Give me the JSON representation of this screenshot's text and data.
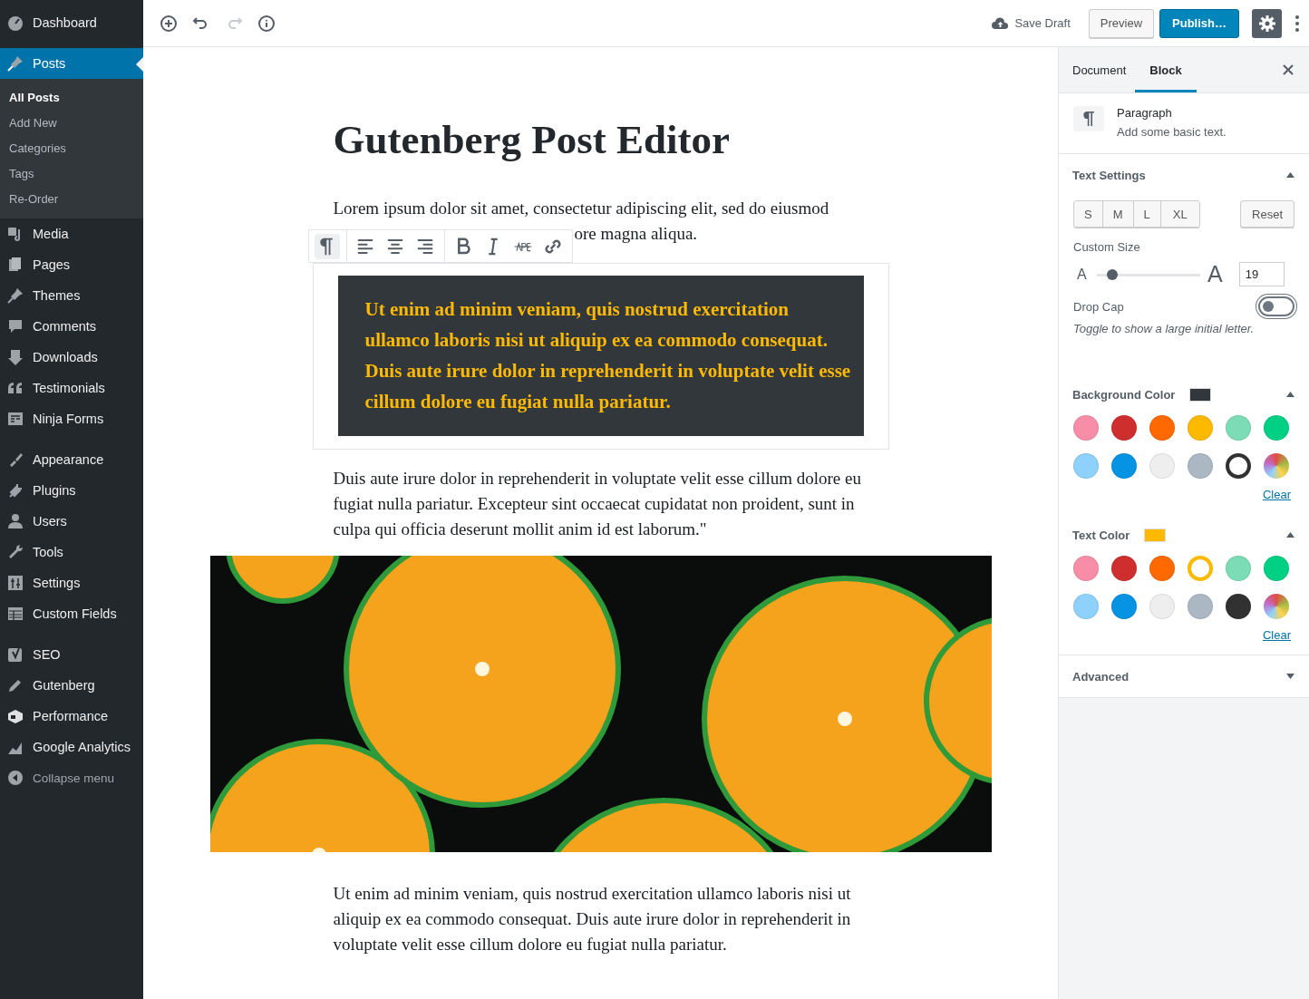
{
  "sidebar": {
    "groups": [
      {
        "items": [
          {
            "label": "Dashboard",
            "selected": false
          }
        ]
      },
      {
        "items": [
          {
            "label": "Posts",
            "selected": true,
            "children": [
              {
                "label": "All Posts",
                "selected": true
              },
              {
                "label": "Add New",
                "selected": false
              },
              {
                "label": "Categories",
                "selected": false
              },
              {
                "label": "Tags",
                "selected": false
              },
              {
                "label": "Re-Order",
                "selected": false
              }
            ]
          },
          {
            "label": "Media",
            "selected": false
          },
          {
            "label": "Pages",
            "selected": false
          },
          {
            "label": "Themes",
            "selected": false
          },
          {
            "label": "Comments",
            "selected": false
          },
          {
            "label": "Downloads",
            "selected": false
          },
          {
            "label": "Testimonials",
            "selected": false
          },
          {
            "label": "Ninja Forms",
            "selected": false
          }
        ]
      },
      {
        "items": [
          {
            "label": "Appearance",
            "selected": false
          },
          {
            "label": "Plugins",
            "selected": false
          },
          {
            "label": "Users",
            "selected": false
          },
          {
            "label": "Tools",
            "selected": false
          },
          {
            "label": "Settings",
            "selected": false
          },
          {
            "label": "Custom Fields",
            "selected": false
          }
        ]
      },
      {
        "items": [
          {
            "label": "SEO",
            "selected": false
          },
          {
            "label": "Gutenberg",
            "selected": false
          },
          {
            "label": "Performance",
            "selected": false
          },
          {
            "label": "Google Analytics",
            "selected": false
          }
        ]
      }
    ],
    "collapse_label": "Collapse menu"
  },
  "topbar": {
    "tools": [
      {
        "disabled": false
      },
      {
        "disabled": false
      },
      {
        "disabled": true
      },
      {
        "disabled": false
      }
    ],
    "save_draft": "Save Draft",
    "preview": "Preview",
    "publish": "Publish…",
    "settings_open": true
  },
  "editor": {
    "title": "Gutenberg Post Editor",
    "block_toolbar": [
      {
        "selected": true
      },
      {
        "selected": false
      },
      {
        "selected": false
      },
      {
        "selected": false
      },
      {
        "selected": false
      },
      {
        "selected": false
      },
      {
        "selected": false
      },
      {
        "selected": false
      }
    ],
    "blocks": [
      {
        "kind": "covered",
        "text": "Lorem ipsum dolor sit amet, consectetur adipiscing elit, sed do eiusmod",
        "tail": "ore magna aliqua."
      },
      {
        "kind": "highlight",
        "selected": true,
        "text": "Ut enim ad minim veniam, quis nostrud exercitation ullamco laboris nisi ut aliquip ex ea commodo consequat. Duis aute irure dolor in reprehenderit in voluptate velit esse cillum dolore eu fugiat nulla pariatur."
      },
      {
        "kind": "paragraph",
        "text": "Duis aute irure dolor in reprehenderit in voluptate velit esse cillum dolore eu fugiat nulla pariatur. Excepteur sint occaecat cupidatat non proident, sunt in culpa qui officia deserunt mollit anim id est laborum.\""
      },
      {
        "kind": "image"
      },
      {
        "kind": "paragraph",
        "text": "Ut enim ad minim veniam, quis nostrud exercitation ullamco laboris nisi ut aliquip ex ea commodo consequat. Duis aute irure dolor in reprehenderit in voluptate velit esse cillum dolore eu fugiat nulla pariatur."
      }
    ]
  },
  "settings": {
    "tabs": [
      {
        "label": "Document",
        "selected": false
      },
      {
        "label": "Block",
        "selected": true
      }
    ],
    "block": {
      "name": "Paragraph",
      "description": "Add some basic text."
    },
    "panels": [
      {
        "kind": "text",
        "title": "Text Settings",
        "expanded": true,
        "sizes": [
          {
            "label": "S",
            "selected": false
          },
          {
            "label": "M",
            "selected": false
          },
          {
            "label": "L",
            "selected": false
          },
          {
            "label": "XL",
            "selected": false
          }
        ],
        "reset": "Reset",
        "custom_size_label": "Custom Size",
        "small_a": "A",
        "large_a": "A",
        "slider": {
          "level": 0.15
        },
        "value": "19",
        "drop_cap": {
          "label": "Drop Cap",
          "on": false,
          "help": "Toggle to show a large initial letter."
        }
      },
      {
        "kind": "color",
        "title": "Background Color",
        "expanded": true,
        "color": "#32373c",
        "clear": "Clear",
        "swatches": [
          {
            "kind": "color",
            "color": "#f78da7",
            "selected": false
          },
          {
            "kind": "color",
            "color": "#cf2e2e",
            "selected": false
          },
          {
            "kind": "color",
            "color": "#ff6900",
            "selected": false
          },
          {
            "kind": "color",
            "color": "#fcb900",
            "selected": false
          },
          {
            "kind": "color",
            "color": "#7bdcb5",
            "selected": false
          },
          {
            "kind": "color",
            "color": "#00d084",
            "selected": false
          },
          {
            "kind": "color",
            "color": "#8ed1fc",
            "selected": false
          },
          {
            "kind": "color",
            "color": "#0693e3",
            "selected": false
          },
          {
            "kind": "color",
            "color": "#eeeeee",
            "selected": false
          },
          {
            "kind": "color",
            "color": "#abb8c3",
            "selected": false
          },
          {
            "kind": "color",
            "color": "#313131",
            "selected": true
          },
          {
            "kind": "custom",
            "selected": false
          }
        ]
      },
      {
        "kind": "color",
        "title": "Text Color",
        "expanded": true,
        "color": "#fcb900",
        "clear": "Clear",
        "swatches": [
          {
            "kind": "color",
            "color": "#f78da7",
            "selected": false
          },
          {
            "kind": "color",
            "color": "#cf2e2e",
            "selected": false
          },
          {
            "kind": "color",
            "color": "#ff6900",
            "selected": false
          },
          {
            "kind": "color",
            "color": "#fcb900",
            "selected": true
          },
          {
            "kind": "color",
            "color": "#7bdcb5",
            "selected": false
          },
          {
            "kind": "color",
            "color": "#00d084",
            "selected": false
          },
          {
            "kind": "color",
            "color": "#8ed1fc",
            "selected": false
          },
          {
            "kind": "color",
            "color": "#0693e3",
            "selected": false
          },
          {
            "kind": "color",
            "color": "#eeeeee",
            "selected": false
          },
          {
            "kind": "color",
            "color": "#abb8c3",
            "selected": false
          },
          {
            "kind": "color",
            "color": "#313131",
            "selected": false
          },
          {
            "kind": "custom",
            "selected": false
          }
        ]
      },
      {
        "kind": "plain",
        "title": "Advanced",
        "expanded": false
      }
    ]
  }
}
